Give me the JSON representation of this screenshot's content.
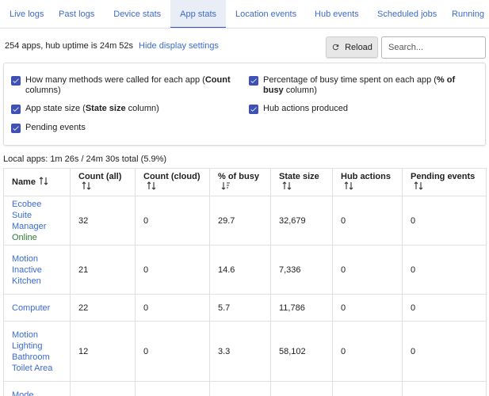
{
  "tabs": [
    {
      "label": "Live logs"
    },
    {
      "label": "Past logs"
    },
    {
      "label": "Device stats"
    },
    {
      "label": "App stats"
    },
    {
      "label": "Location events"
    },
    {
      "label": "Hub events"
    },
    {
      "label": "Scheduled jobs"
    },
    {
      "label": "Running"
    }
  ],
  "active_tab": "App stats",
  "summary": {
    "text": "254 apps, hub uptime is 24m 52s",
    "hide_link": "Hide display settings"
  },
  "reload_label": "Reload",
  "search_placeholder": "Search...",
  "settings": [
    {
      "pre": "How many methods were called for each app (",
      "bold": "Count",
      "post": " columns)",
      "checked": true
    },
    {
      "pre": "Percentage of busy time spent on each app (",
      "bold": "% of busy",
      "post": " column)",
      "checked": true
    },
    {
      "pre": "App state size (",
      "bold": "State size",
      "post": " column)",
      "checked": true
    },
    {
      "pre": "Hub actions produced",
      "bold": "",
      "post": "",
      "checked": true
    },
    {
      "pre": "Pending events",
      "bold": "",
      "post": "",
      "checked": true
    }
  ],
  "local_apps_text": "Local apps: 1m 26s / 24m 30s total (5.9%)",
  "table": {
    "headers": [
      "Name",
      "Count (all)",
      "Count (cloud)",
      "% of busy",
      "State size",
      "Hub actions",
      "Pending events"
    ],
    "rows": [
      {
        "name": "Ecobee Suite Manager",
        "status": "Online",
        "count_all": "32",
        "count_cloud": "0",
        "busy": "29.7",
        "state": "32,679",
        "hub": "0",
        "pending": "0"
      },
      {
        "name": "Motion Inactive Kitchen",
        "status": "",
        "count_all": "21",
        "count_cloud": "0",
        "busy": "14.6",
        "state": "7,336",
        "hub": "0",
        "pending": "0"
      },
      {
        "name": "Computer",
        "status": "",
        "count_all": "22",
        "count_cloud": "0",
        "busy": "5.7",
        "state": "11,786",
        "hub": "0",
        "pending": "0"
      },
      {
        "name": "Motion Lighting Bathroom Toilet Area",
        "status": "",
        "count_all": "12",
        "count_cloud": "0",
        "busy": "3.3",
        "state": "58,102",
        "hub": "0",
        "pending": "0"
      },
      {
        "name": "Mode Boolean",
        "status": "",
        "count_all": "",
        "count_cloud": "",
        "busy": "",
        "state": "",
        "hub": "",
        "pending": ""
      }
    ]
  },
  "colors": {
    "link": "#3b6bd0",
    "checkbox": "#3f51b5",
    "online": "#2e7d32",
    "active_tab_bg": "#e8edf6"
  }
}
